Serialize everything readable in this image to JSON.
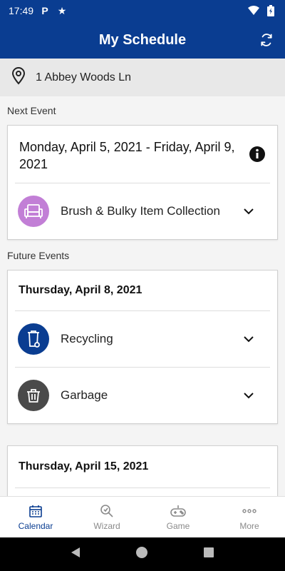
{
  "status_bar": {
    "time": "17:49",
    "p_badge": "P"
  },
  "app_bar": {
    "title": "My Schedule"
  },
  "address": {
    "text": "1 Abbey Woods Ln"
  },
  "next_event": {
    "section_label": "Next Event",
    "date": "Monday, April 5, 2021 - Friday, April 9, 2021",
    "event": {
      "label": "Brush & Bulky Item Collection",
      "icon": "sofa-icon",
      "color": "#c27fd6"
    }
  },
  "future_events": {
    "section_label": "Future Events",
    "groups": [
      {
        "date": "Thursday, April 8, 2021",
        "events": [
          {
            "label": "Recycling",
            "icon": "recycling-bin-icon",
            "color": "#0a3d91"
          },
          {
            "label": "Garbage",
            "icon": "garbage-bin-icon",
            "color": "#4a4a4a"
          }
        ]
      },
      {
        "date": "Thursday, April 15, 2021",
        "events": []
      }
    ]
  },
  "bottom_nav": {
    "items": [
      {
        "label": "Calendar",
        "active": true
      },
      {
        "label": "Wizard",
        "active": false
      },
      {
        "label": "Game",
        "active": false
      },
      {
        "label": "More",
        "active": false
      }
    ]
  },
  "colors": {
    "primary": "#0a3d91",
    "bulky": "#c27fd6",
    "garbage": "#4a4a4a"
  }
}
